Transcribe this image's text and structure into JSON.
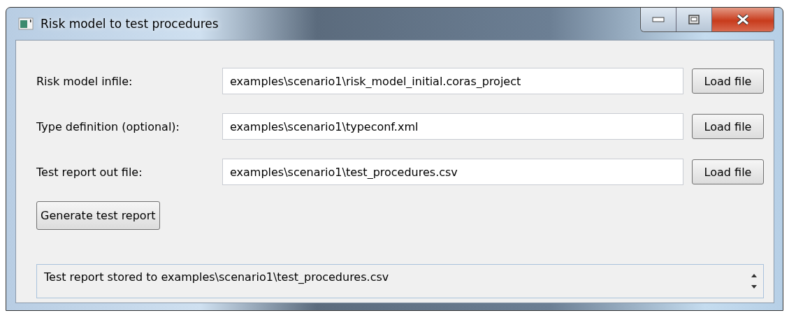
{
  "window": {
    "title": "Risk model to test procedures"
  },
  "rows": [
    {
      "label": "Risk model infile:",
      "value": "examples\\scenario1\\risk_model_initial.coras_project",
      "button": "Load file"
    },
    {
      "label": "Type definition (optional):",
      "value": "examples\\scenario1\\typeconf.xml",
      "button": "Load file"
    },
    {
      "label": "Test report out file:",
      "value": "examples\\scenario1\\test_procedures.csv",
      "button": "Load file"
    }
  ],
  "generate_button": "Generate test report",
  "status": {
    "text": "Test report stored to examples\\scenario1\\test_procedures.csv"
  }
}
